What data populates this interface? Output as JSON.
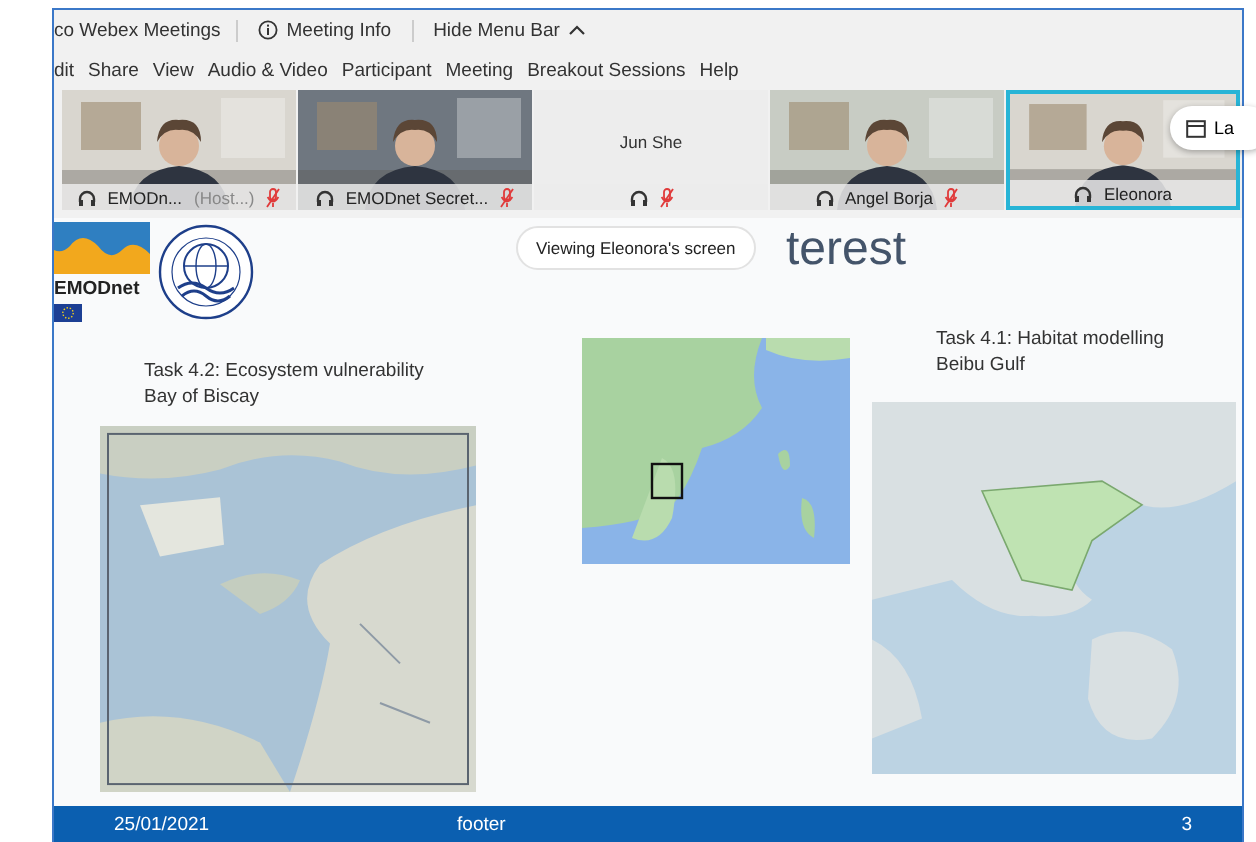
{
  "top_bar": {
    "app_title": "co Webex Meetings",
    "meeting_info": "Meeting Info",
    "hide_menu": "Hide Menu Bar"
  },
  "menu": [
    "dit",
    "Share",
    "View",
    "Audio & Video",
    "Participant",
    "Meeting",
    "Breakout Sessions",
    "Help"
  ],
  "participants": [
    {
      "name": "EMODn...",
      "role": "(Host...)",
      "video": true,
      "muted": true,
      "active_speaker": false
    },
    {
      "name": "EMODnet Secret...",
      "video": true,
      "muted": true,
      "active_speaker": false
    },
    {
      "name": "Jun She",
      "video": false,
      "muted": true,
      "active_speaker": false
    },
    {
      "name": "Angel Borja",
      "video": true,
      "muted": true,
      "active_speaker": false
    },
    {
      "name": "Eleonora",
      "video": true,
      "muted": false,
      "active_speaker": true
    }
  ],
  "layout_button": "La",
  "viewing_badge": "Viewing Eleonora's screen",
  "slide": {
    "title": "terest",
    "logo_text": "EMODnet",
    "left_task": {
      "title": "Task 4.2: Ecosystem vulnerability",
      "subtitle": "Bay of Biscay"
    },
    "right_task": {
      "title": "Task 4.1: Habitat modelling",
      "subtitle": "Beibu Gulf"
    },
    "footer": {
      "date": "25/01/2021",
      "text": "footer",
      "page": "3"
    }
  }
}
